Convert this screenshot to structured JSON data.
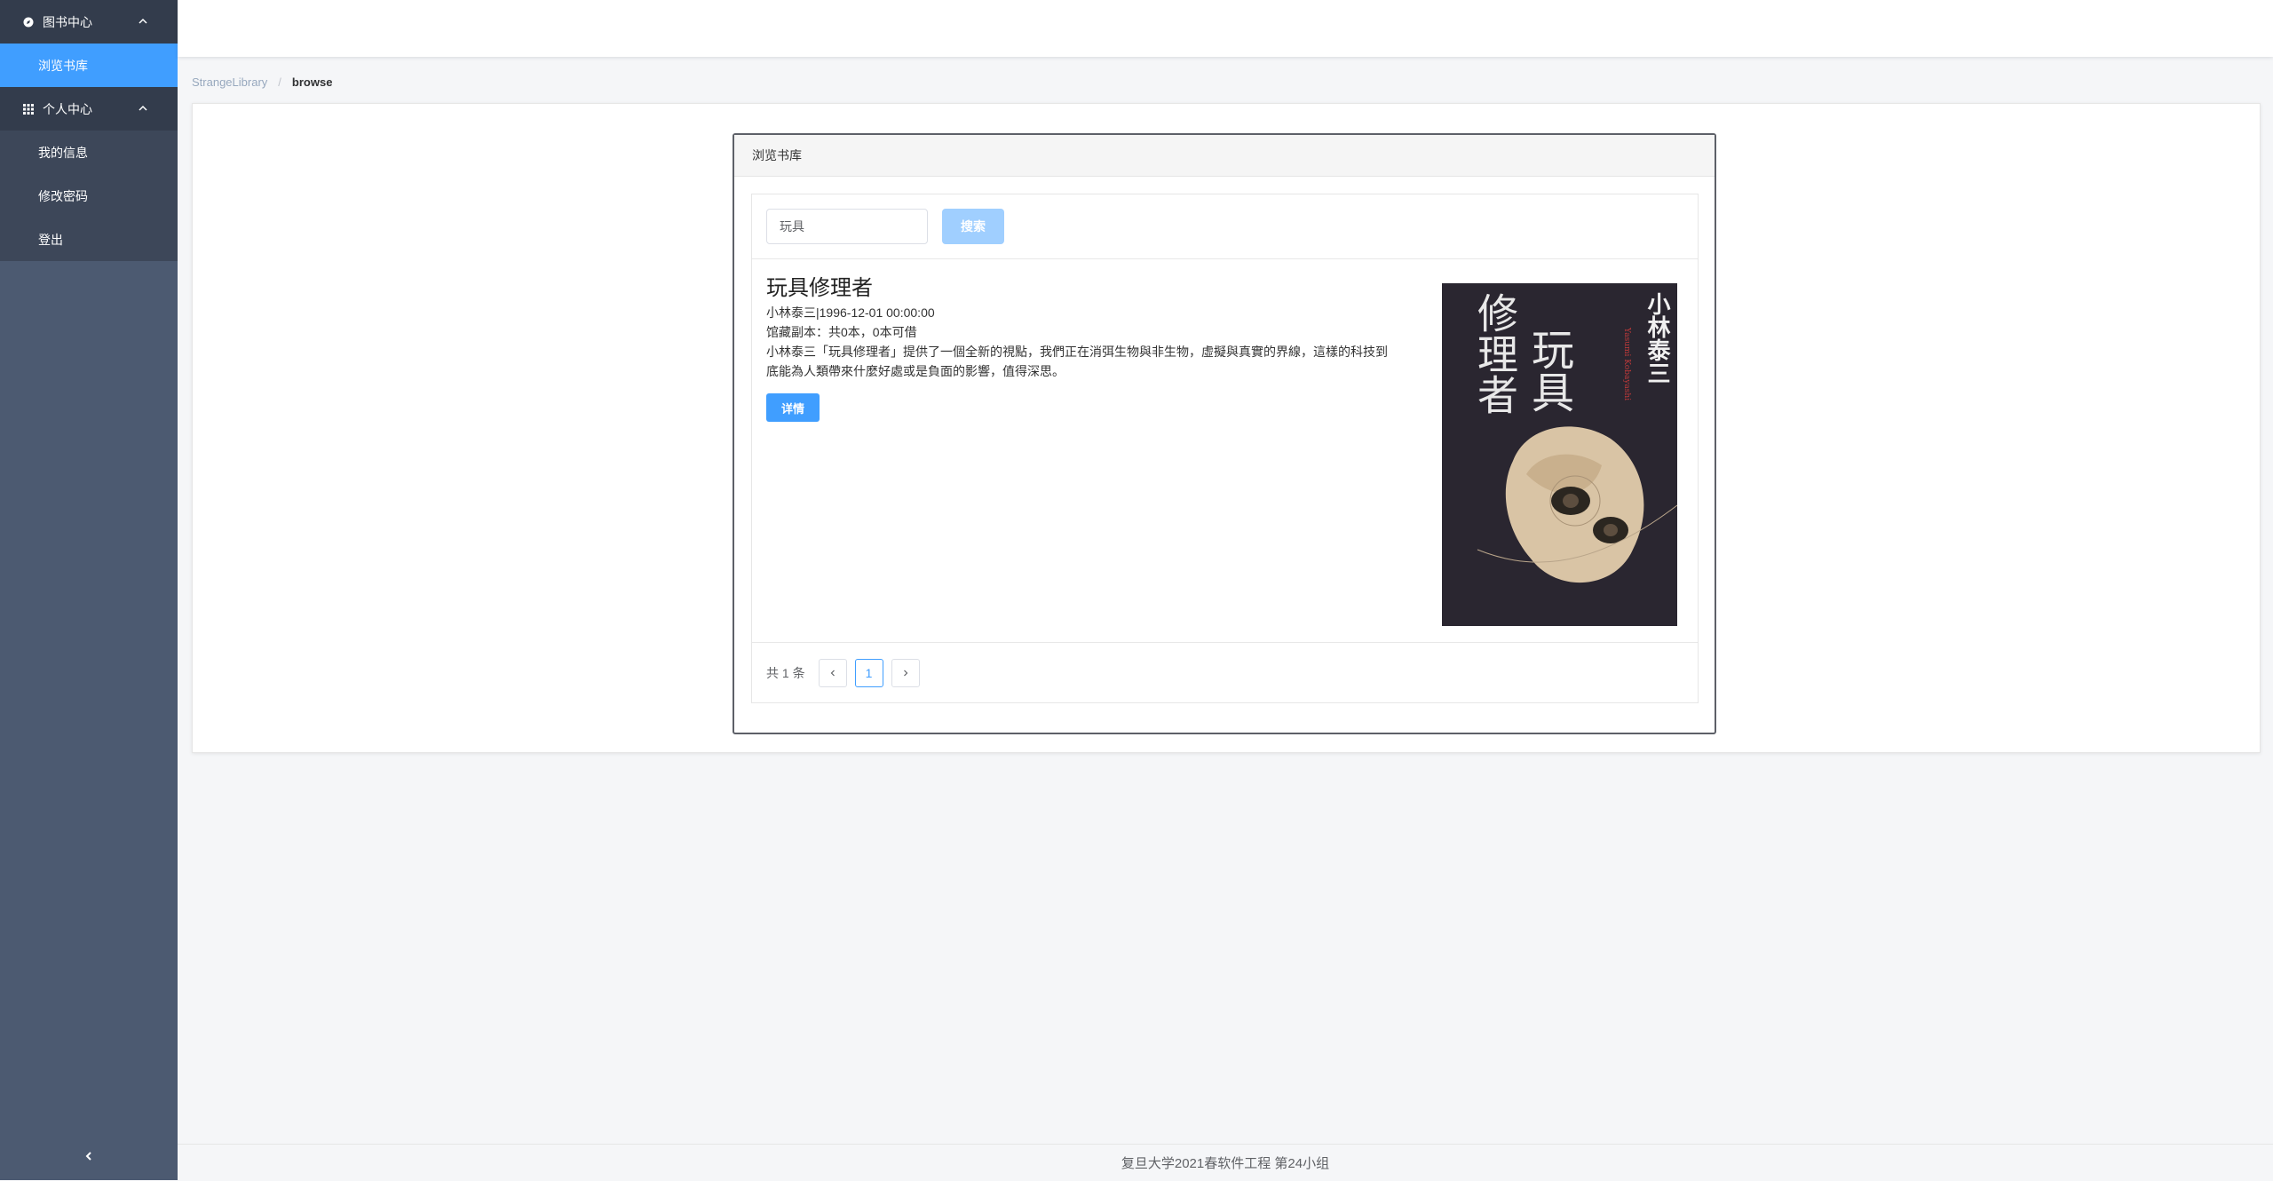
{
  "sidebar": {
    "groups": [
      {
        "title": "图书中心",
        "items": [
          {
            "label": "浏览书库",
            "active": true
          }
        ]
      },
      {
        "title": "个人中心",
        "items": [
          {
            "label": "我的信息"
          },
          {
            "label": "修改密码"
          },
          {
            "label": "登出"
          }
        ]
      }
    ]
  },
  "breadcrumb": {
    "root": "StrangeLibrary",
    "separator": "/",
    "current": "browse"
  },
  "card": {
    "title": "浏览书库"
  },
  "search": {
    "value": "玩具",
    "button_label": "搜索"
  },
  "book": {
    "title": "玩具修理者",
    "author_date": "小林泰三|1996-12-01 00:00:00",
    "copies": "馆藏副本：共0本，0本可借",
    "description": "小林泰三「玩具修理者」提供了一個全新的視點，我們正在消弭生物與非生物，虛擬與真實的界線，這樣的科技到底能為人類帶來什麼好處或是負面的影響，值得深思。",
    "detail_button": "详情",
    "cover": {
      "title_line1": "玩具",
      "title_line2": "修理者",
      "author": "小林泰三",
      "author_romaji": "Yasumi Kobayashi"
    }
  },
  "pagination": {
    "total": "共 1 条",
    "current_page": "1"
  },
  "footer": {
    "text": "复旦大学2021春软件工程 第24小组"
  },
  "colors": {
    "primary": "#409eff",
    "sidebar_bg": "#4c5a71",
    "submenu_bg": "#333c4c"
  }
}
